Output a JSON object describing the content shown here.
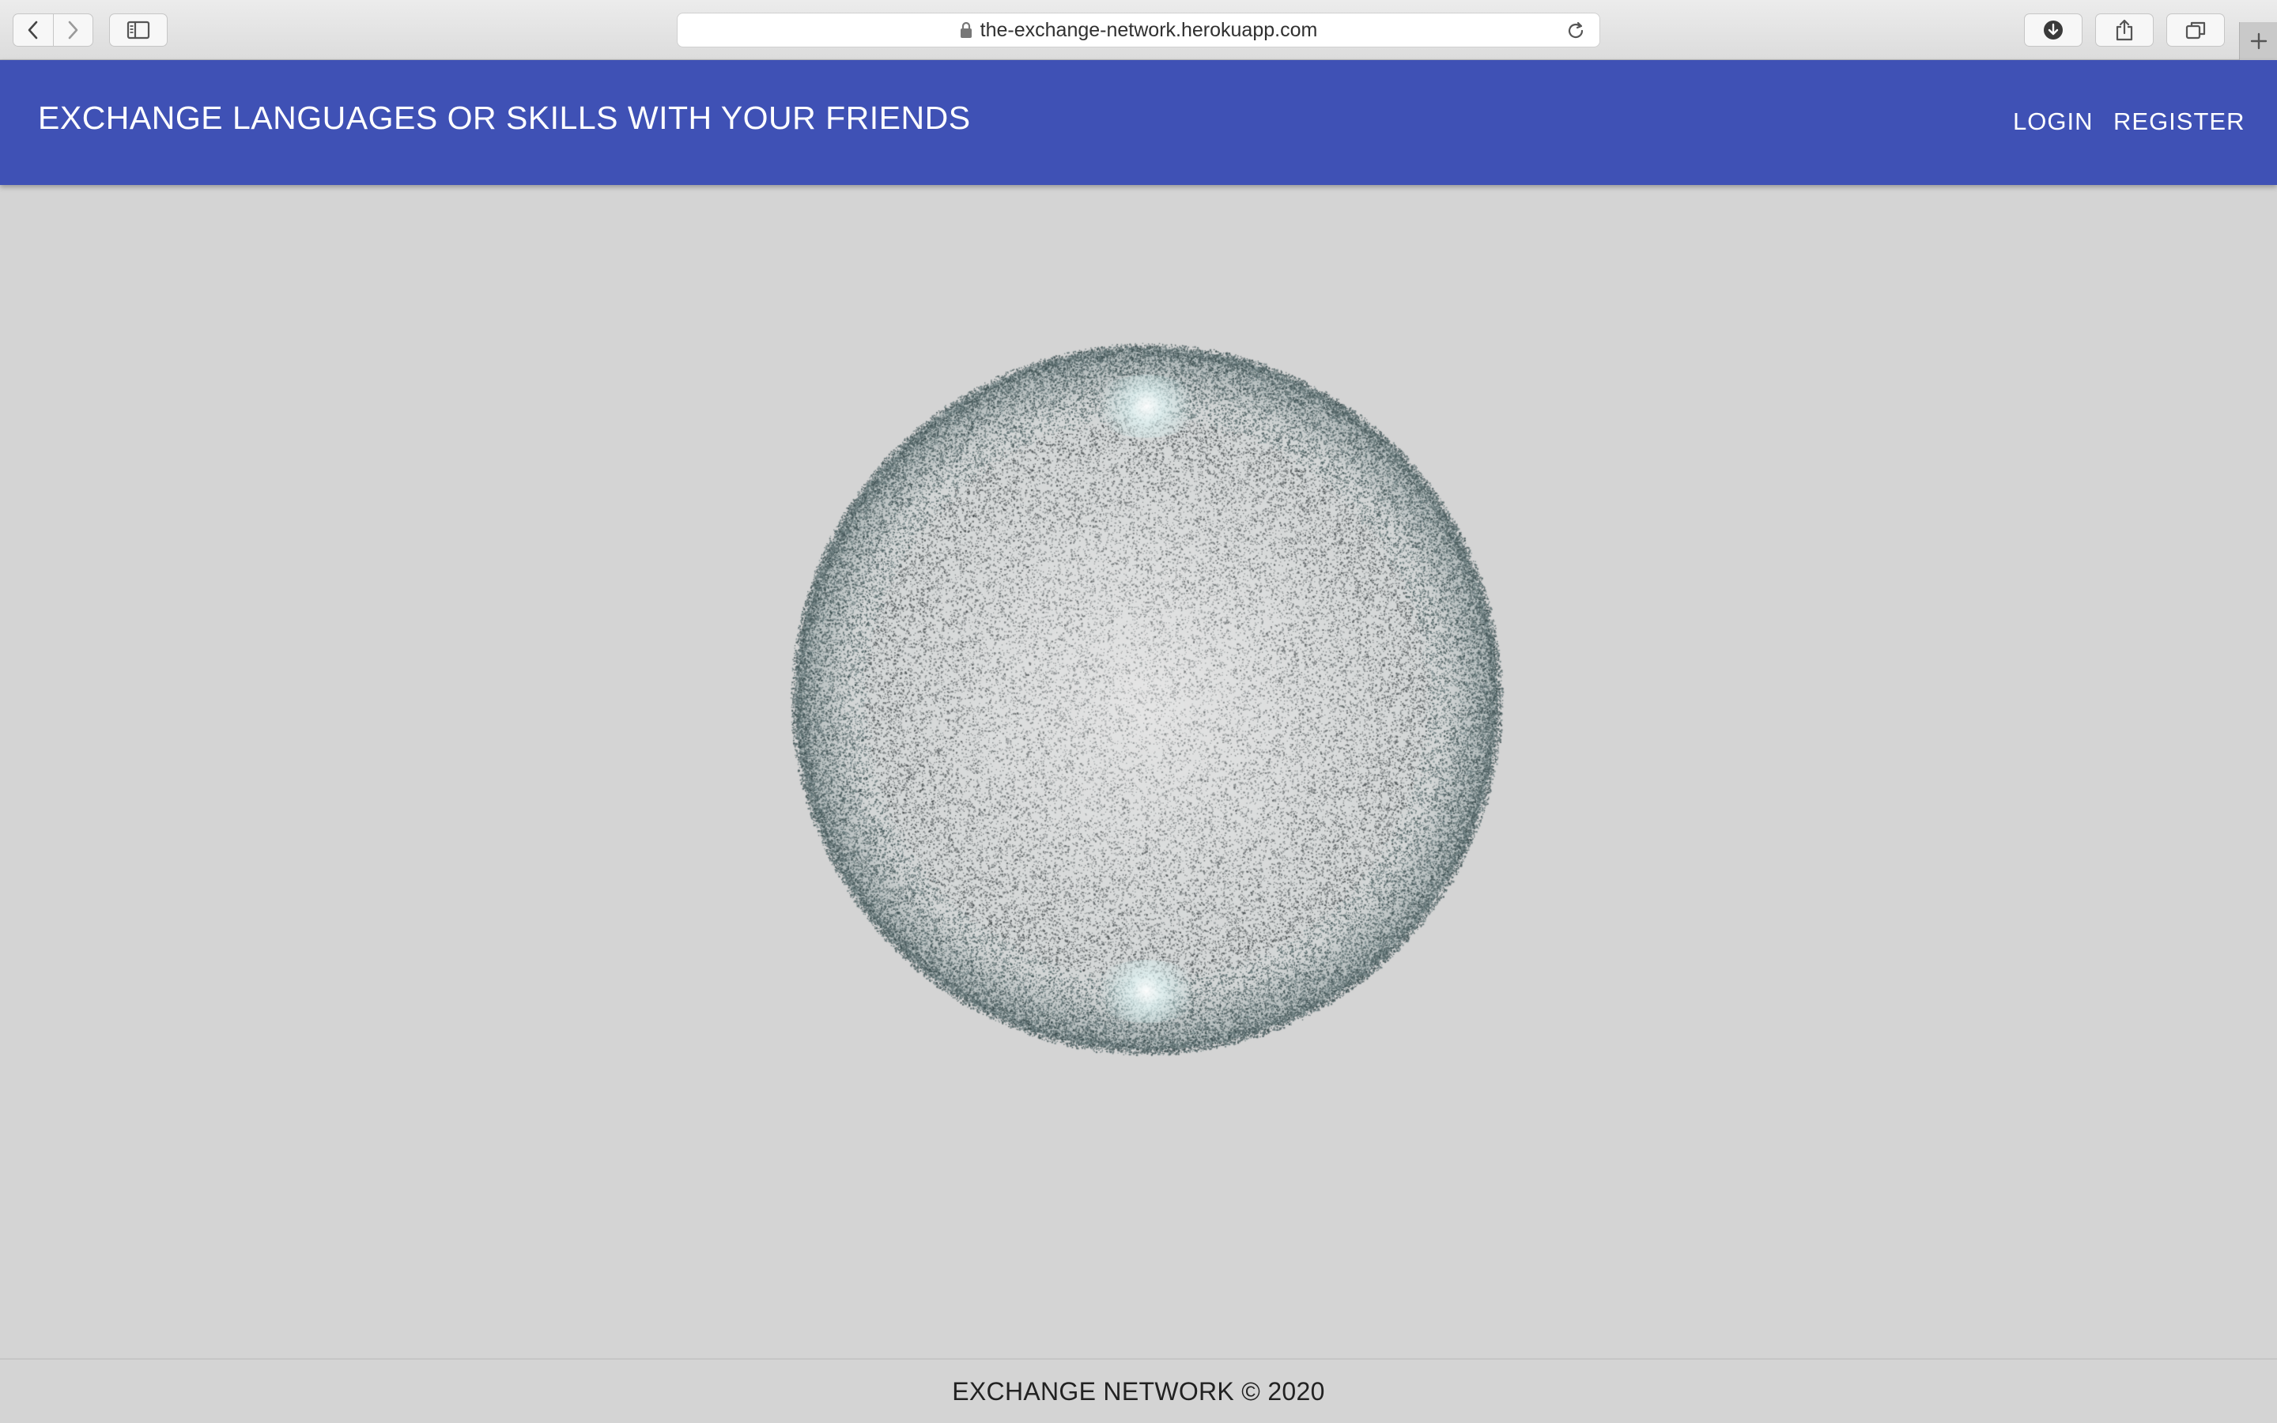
{
  "browser": {
    "url": "the-exchange-network.herokuapp.com",
    "icons": {
      "back": "chevron-left-icon",
      "forward": "chevron-right-icon",
      "sidebar": "sidebar-icon",
      "lock": "lock-icon",
      "reload": "reload-icon",
      "download": "download-icon",
      "share": "share-icon",
      "tabs": "tabs-icon",
      "new_tab": "plus-icon"
    }
  },
  "header": {
    "title": "EXCHANGE LANGUAGES OR SKILLS WITH YOUR FRIENDS",
    "nav": {
      "login": "LOGIN",
      "register": "REGISTER"
    },
    "background_color": "#3f51b5"
  },
  "main": {
    "visual": "particle-sphere",
    "background_color": "#d4d4d4"
  },
  "footer": {
    "text": "EXCHANGE NETWORK © 2020"
  }
}
